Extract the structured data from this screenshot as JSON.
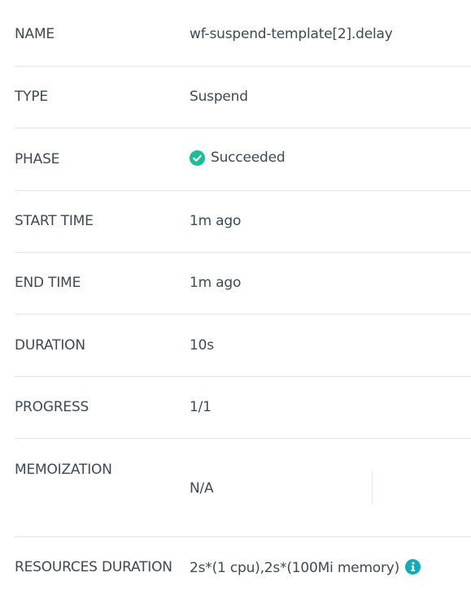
{
  "rows": {
    "name": {
      "label": "NAME",
      "value": "wf-suspend-template[2].delay"
    },
    "type": {
      "label": "TYPE",
      "value": "Suspend"
    },
    "phase": {
      "label": "PHASE",
      "value": "Succeeded",
      "icon": "check-circle-icon",
      "status_color": "#18be94"
    },
    "start_time": {
      "label": "START TIME",
      "value": "1m ago"
    },
    "end_time": {
      "label": "END TIME",
      "value": "1m ago"
    },
    "duration": {
      "label": "DURATION",
      "value": "10s"
    },
    "progress": {
      "label": "PROGRESS",
      "value": "1/1"
    },
    "memoization": {
      "label": "MEMOIZATION",
      "value": "N/A"
    },
    "resources_duration": {
      "label": "RESOURCES DURATION",
      "value": "2s*(1 cpu),2s*(100Mi memory)",
      "icon": "info-icon",
      "icon_color": "#0dadbb"
    }
  }
}
